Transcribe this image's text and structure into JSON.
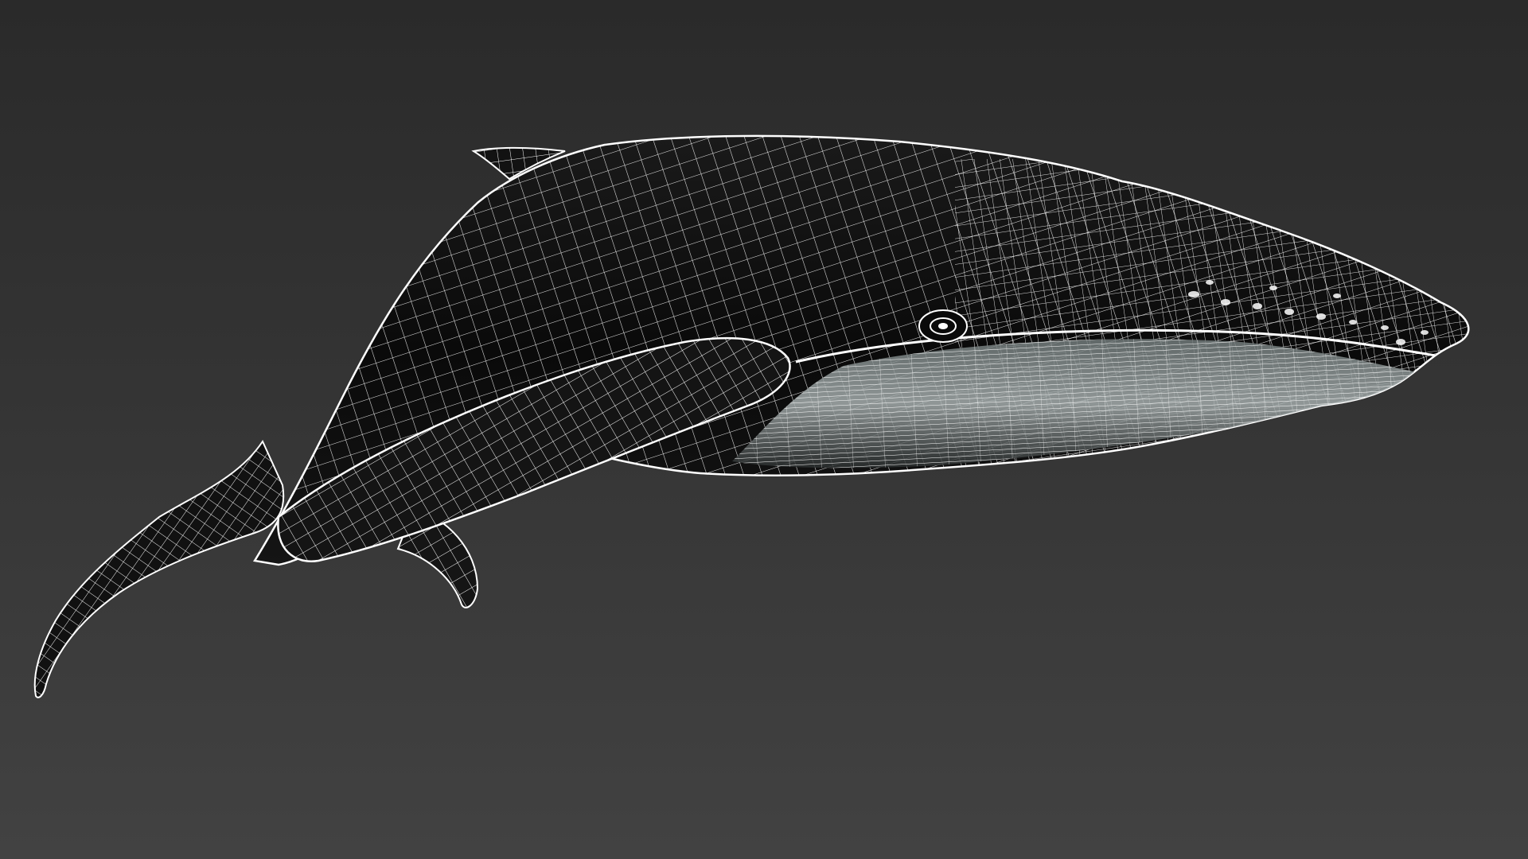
{
  "scene": {
    "subject": "humpback-whale-wireframe",
    "render_mode": "wireframe",
    "colors": {
      "background_top": "#2a2a2a",
      "background_bottom": "#424242",
      "mesh_wire": "#ffffff",
      "body_fill": "#0b0b0b",
      "body_fill_light": "#2a2a2a",
      "mouth_highlight": "#9aa3a3"
    }
  }
}
